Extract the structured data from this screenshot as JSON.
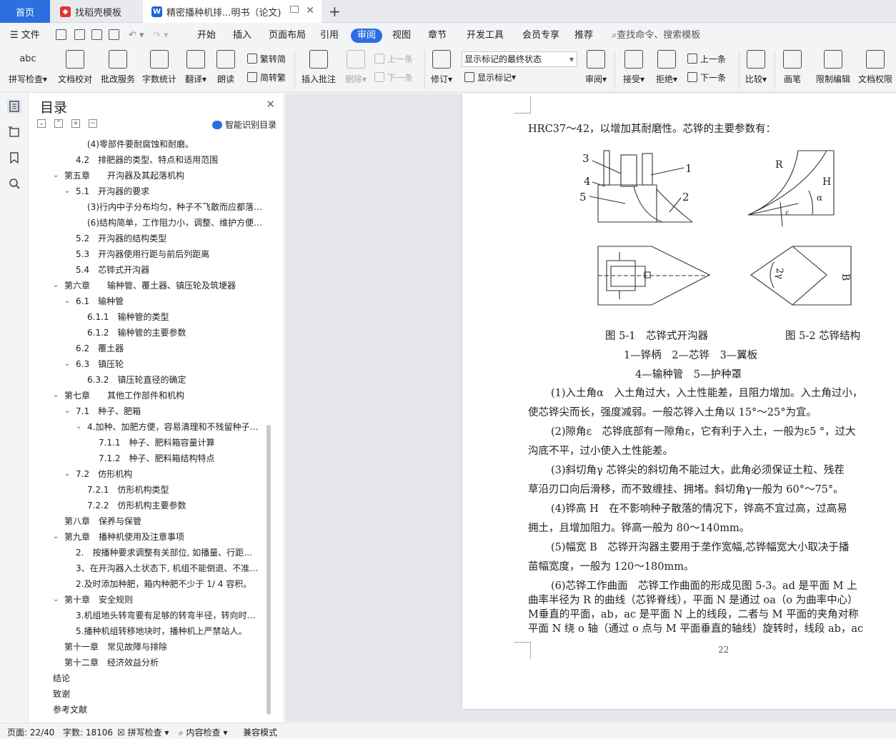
{
  "tabs": {
    "home": "首页",
    "template": "找稻壳模板",
    "document": "精密播种机排...明书（论文)"
  },
  "menu": {
    "file": "文件",
    "items": [
      "开始",
      "插入",
      "页面布局",
      "引用",
      "审阅",
      "视图",
      "章节",
      "开发工具",
      "会员专享",
      "推荐"
    ],
    "active": "审阅",
    "search": "查找命令、搜索模板"
  },
  "ribbon": {
    "spell_check": "拼写检查",
    "doc_proof": "文档校对",
    "proof_service": "批改服务",
    "word_count": "字数统计",
    "translate": "翻译",
    "read_aloud": "朗读",
    "trad_to_simp": "繁转简",
    "simp_to_trad": "简转繁",
    "insert_comment": "插入批注",
    "delete": "删除",
    "prev_comment": "上一条",
    "next_comment": "下一条",
    "track_changes": "修订",
    "markup_state": "显示标记的最终状态",
    "show_markup": "显示标记",
    "review_pane": "审阅",
    "accept": "接受",
    "reject": "拒绝",
    "prev_change": "上一条",
    "next_change": "下一条",
    "compare": "比较",
    "pen": "画笔",
    "restrict_edit": "限制编辑",
    "doc_permission": "文档权限"
  },
  "toc": {
    "title": "目录",
    "smart": "智能识别目录",
    "items": [
      {
        "text": "(4)零部件要耐腐蚀和耐磨。",
        "level": 3,
        "arrow": ""
      },
      {
        "text": "4.2　排肥器的类型、特点和适用范围",
        "level": 1,
        "arrow": ""
      },
      {
        "text": "第五章　　开沟器及其起落机构",
        "level": 0,
        "arrow": "v"
      },
      {
        "text": "5.1　开沟器的要求",
        "level": 1,
        "arrow": "v"
      },
      {
        "text": "(3)行内中子分布均匀，种子不飞散而应都落…",
        "level": 3,
        "arrow": ""
      },
      {
        "text": "(6)结构简单，工作阻力小，调整、维护方便…",
        "level": 3,
        "arrow": ""
      },
      {
        "text": "5.2　开沟器的结构类型",
        "level": 1,
        "arrow": ""
      },
      {
        "text": "5.3　开沟器使用行距与前后列距离",
        "level": 1,
        "arrow": ""
      },
      {
        "text": "5.4　芯铧式开沟器",
        "level": 1,
        "arrow": ""
      },
      {
        "text": "第六章　　输种管、覆土器、镇压轮及筑埂器",
        "level": 0,
        "arrow": "v"
      },
      {
        "text": "6.1　输种管",
        "level": 1,
        "arrow": "v"
      },
      {
        "text": "6.1.1　输种管的类型",
        "level": 3,
        "arrow": ""
      },
      {
        "text": "6.1.2　输种管的主要参数",
        "level": 3,
        "arrow": ""
      },
      {
        "text": "6.2　覆土器",
        "level": 1,
        "arrow": ""
      },
      {
        "text": "6.3　镇压轮",
        "level": 1,
        "arrow": "v"
      },
      {
        "text": "6.3.2　镇压轮直径的确定",
        "level": 3,
        "arrow": ""
      },
      {
        "text": "第七章　　其他工作部件和机构",
        "level": 0,
        "arrow": "v"
      },
      {
        "text": "7.1　种子、肥箱",
        "level": 1,
        "arrow": "v"
      },
      {
        "text": "4.加种、加肥方便，容易清理和不残留种子…",
        "level": 2,
        "arrow": "v"
      },
      {
        "text": "7.1.1　种子、肥料箱容量计算",
        "level": 4,
        "arrow": ""
      },
      {
        "text": "7.1.2　种子、肥料箱结构特点",
        "level": 4,
        "arrow": ""
      },
      {
        "text": "7.2　仿形机构",
        "level": 1,
        "arrow": "v"
      },
      {
        "text": "7.2.1　仿形机构类型",
        "level": 3,
        "arrow": ""
      },
      {
        "text": "7.2.2　仿形机构主要参数",
        "level": 3,
        "arrow": ""
      },
      {
        "text": "第八章　保养与保管",
        "level": 0,
        "arrow": ""
      },
      {
        "text": "第九章　播种机使用及注意事项",
        "level": 0,
        "arrow": "v"
      },
      {
        "text": "2.　按播种要求调整有关部位, 如播量、行距…",
        "level": 1,
        "arrow": ""
      },
      {
        "text": "3、在开沟器入土状态下, 机组不能倒退、不准…",
        "level": 1,
        "arrow": ""
      },
      {
        "text": "2.及时添加种肥，箱内种肥不少于 1/ 4 容积。",
        "level": 1,
        "arrow": ""
      },
      {
        "text": "第十章　安全规则",
        "level": 0,
        "arrow": "v"
      },
      {
        "text": "3.机组地头转弯要有足够的转弯半径，转向时…",
        "level": 1,
        "arrow": ""
      },
      {
        "text": "5.播种机组转移地块时，播种机上严禁站人。",
        "level": 1,
        "arrow": ""
      },
      {
        "text": "第十一章　常见故障与排除",
        "level": 0,
        "arrow": ""
      },
      {
        "text": "第十二章　经济效益分析",
        "level": 0,
        "arrow": ""
      },
      {
        "text": "结论",
        "level": -1,
        "arrow": ""
      },
      {
        "text": "致谢",
        "level": -1,
        "arrow": ""
      },
      {
        "text": "参考文献",
        "level": -1,
        "arrow": ""
      }
    ]
  },
  "document": {
    "intro": "HRC37～42，以增加其耐磨性。芯铧的主要参数有：",
    "fig_labels_left": [
      "3",
      "4",
      "5",
      "1",
      "2"
    ],
    "fig_labels_right": [
      "R",
      "H",
      "α",
      "ε"
    ],
    "fig_label_angle": "2γ",
    "fig_label_width": "B",
    "caption1": "图 5-1　芯铧式开沟器",
    "caption2": "图 5-2  芯铧结构",
    "legend1": "1—铧柄　2—芯铧　3—翼板",
    "legend2": "4—输种管　5—护种罩",
    "paragraphs": [
      "(1)入土角α　入土角过大，入土性能差，且阻力增加。入土角过小，",
      "使芯铧尖而长，强度减弱。一般芯铧入土角以 15°～25°为宜。",
      "(2)隙角ε　芯铧底部有一隙角ε，它有利于入土，一般为ε5 °，过大",
      "沟底不平，过小使入土性能差。",
      "(3)斜切角γ 芯铧尖的斜切角不能过大，此角必须保证土粒、残茬",
      "草沿刃口向后滑移，而不致缠挂、拥堵。斜切角γ一般为 60°～75°。",
      "(4)铧高 H　在不影响种子散落的情况下，铧高不宜过高，过高易",
      "拥土，且增加阻力。铧高一般为 80～140mm。",
      "(5)幅宽 B　芯铧开沟器主要用于垄作宽幅,芯铧幅宽大小取决于播",
      "苗幅宽度，一般为 120～180mm。",
      "(6)芯铧工作曲面　芯铧工作曲面的形成见图 5-3。ad 是平面 M 上",
      "曲率半径为 R 的曲线（芯铧脊线），平面 N 是通过 oa（o 为曲率中心）",
      "M垂直的平面，ab，ac 是平面 N 上的线段，二者与 M 平面的夹角对称",
      "平面 N 绕 o 轴（通过 o 点与 M 平面垂直的轴线）旋转时，线段 ab，ac"
    ],
    "page_number": "22"
  },
  "status": {
    "page": "页面: 22/40",
    "words": "字数: 18106",
    "spell": "拼写检查",
    "content_check": "内容检查",
    "compat": "兼容模式"
  }
}
